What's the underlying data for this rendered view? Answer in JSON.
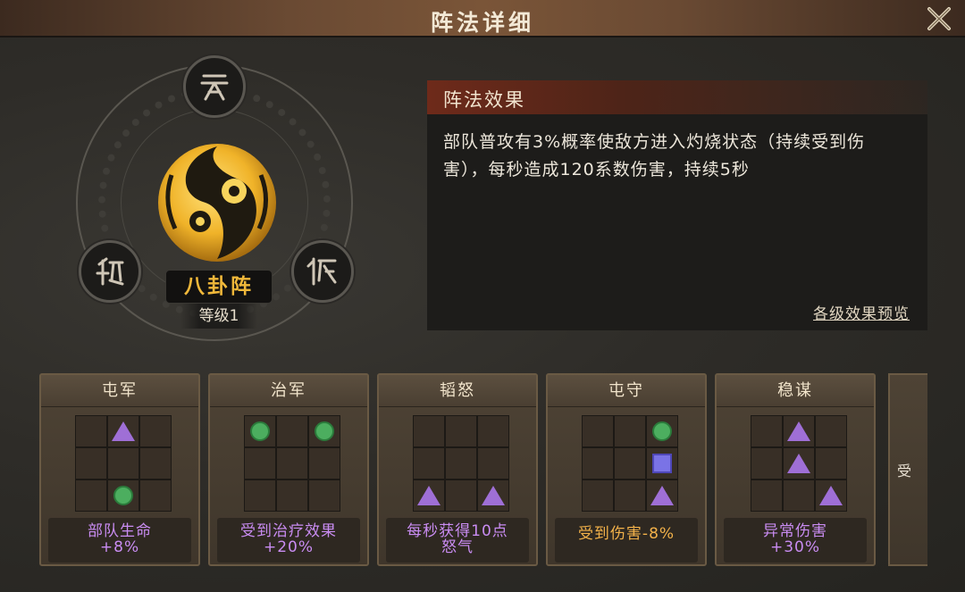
{
  "window": {
    "title": "阵法详细",
    "close_icon": "close-x-icon"
  },
  "formation": {
    "name": "八卦阵",
    "level": "等级1",
    "nodes": [
      {
        "icon": "heaven-rune-icon"
      },
      {
        "icon": "earth-rune-icon"
      },
      {
        "icon": "human-rune-icon"
      }
    ],
    "center_icon": "taiji-emblem-icon"
  },
  "effect": {
    "heading": "阵法效果",
    "description": "部队普攻有3%概率使敌方进入灼烧状态（持续受到伤害），每秒造成120系数伤害，持续5秒",
    "preview_link": "各级效果预览"
  },
  "cards": [
    {
      "title": "屯军",
      "effect": "部队生命\n+8%",
      "pieces": [
        {
          "cell": 1,
          "shape": "triangle"
        },
        {
          "cell": 7,
          "shape": "circle"
        }
      ]
    },
    {
      "title": "治军",
      "effect": "受到治疗效果\n+20%",
      "pieces": [
        {
          "cell": 0,
          "shape": "circle"
        },
        {
          "cell": 2,
          "shape": "circle"
        }
      ]
    },
    {
      "title": "韬怒",
      "effect": "每秒获得10点\n怒气",
      "pieces": [
        {
          "cell": 6,
          "shape": "triangle"
        },
        {
          "cell": 8,
          "shape": "triangle"
        }
      ]
    },
    {
      "title": "屯守",
      "effect": "受到伤害-8%",
      "pieces": [
        {
          "cell": 2,
          "shape": "circle"
        },
        {
          "cell": 5,
          "shape": "square"
        },
        {
          "cell": 8,
          "shape": "triangle"
        }
      ]
    },
    {
      "title": "稳谋",
      "effect": "异常伤害\n+30%",
      "pieces": [
        {
          "cell": 1,
          "shape": "triangle"
        },
        {
          "cell": 4,
          "shape": "triangle"
        },
        {
          "cell": 8,
          "shape": "triangle"
        }
      ]
    }
  ],
  "partial_card": {
    "text": "受"
  },
  "colors": {
    "gold": "#f0b83a",
    "purple_text": "#c98cf2",
    "orange_text": "#f3b24a",
    "circle": "#4cae5f",
    "square": "#7a73e6",
    "triangle": "#9f6fd6"
  }
}
